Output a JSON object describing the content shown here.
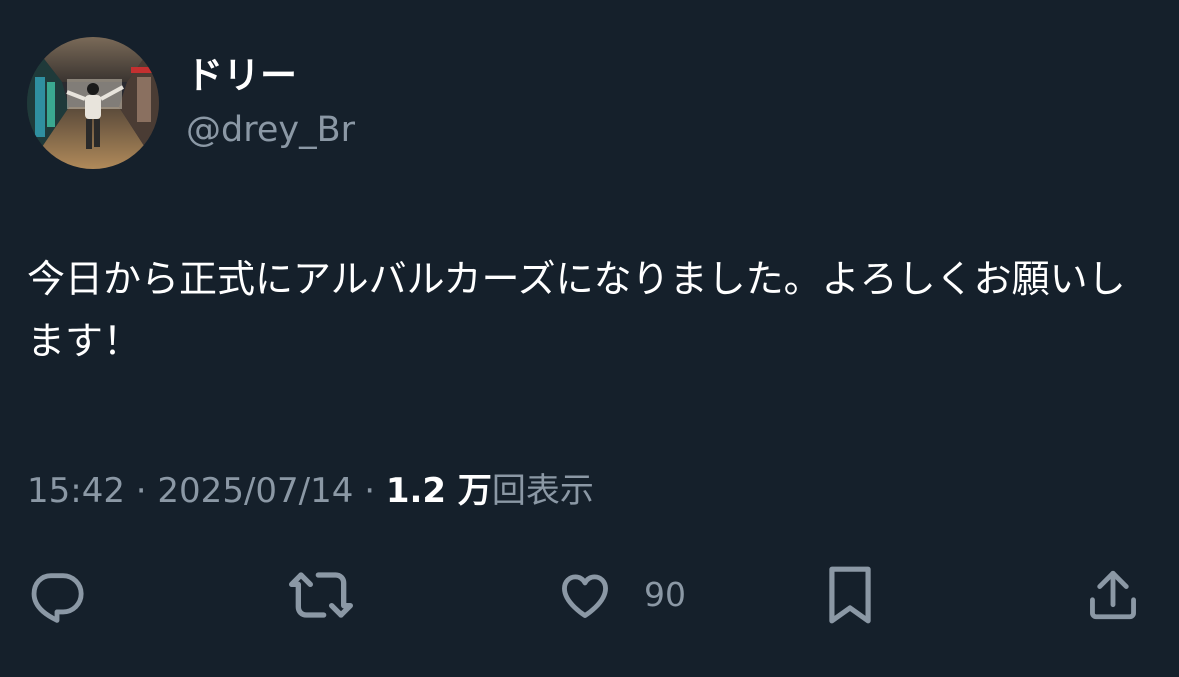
{
  "author": {
    "display_name": "ドリー",
    "handle": "@drey_Br"
  },
  "tweet": {
    "text": "今日から正式にアルバルカーズになりました。よろしくお願いします！",
    "time": "15:42",
    "date": "2025/07/14",
    "views_count": "1.2 万",
    "views_label": "回表示",
    "separator": "·"
  },
  "actions": {
    "reply_icon": "reply-icon",
    "retweet_icon": "retweet-icon",
    "like_icon": "heart-icon",
    "like_count": "90",
    "bookmark_icon": "bookmark-icon",
    "share_icon": "share-icon"
  },
  "colors": {
    "background": "#15202b",
    "primary_text": "#ffffff",
    "secondary_text": "#8b98a5"
  }
}
